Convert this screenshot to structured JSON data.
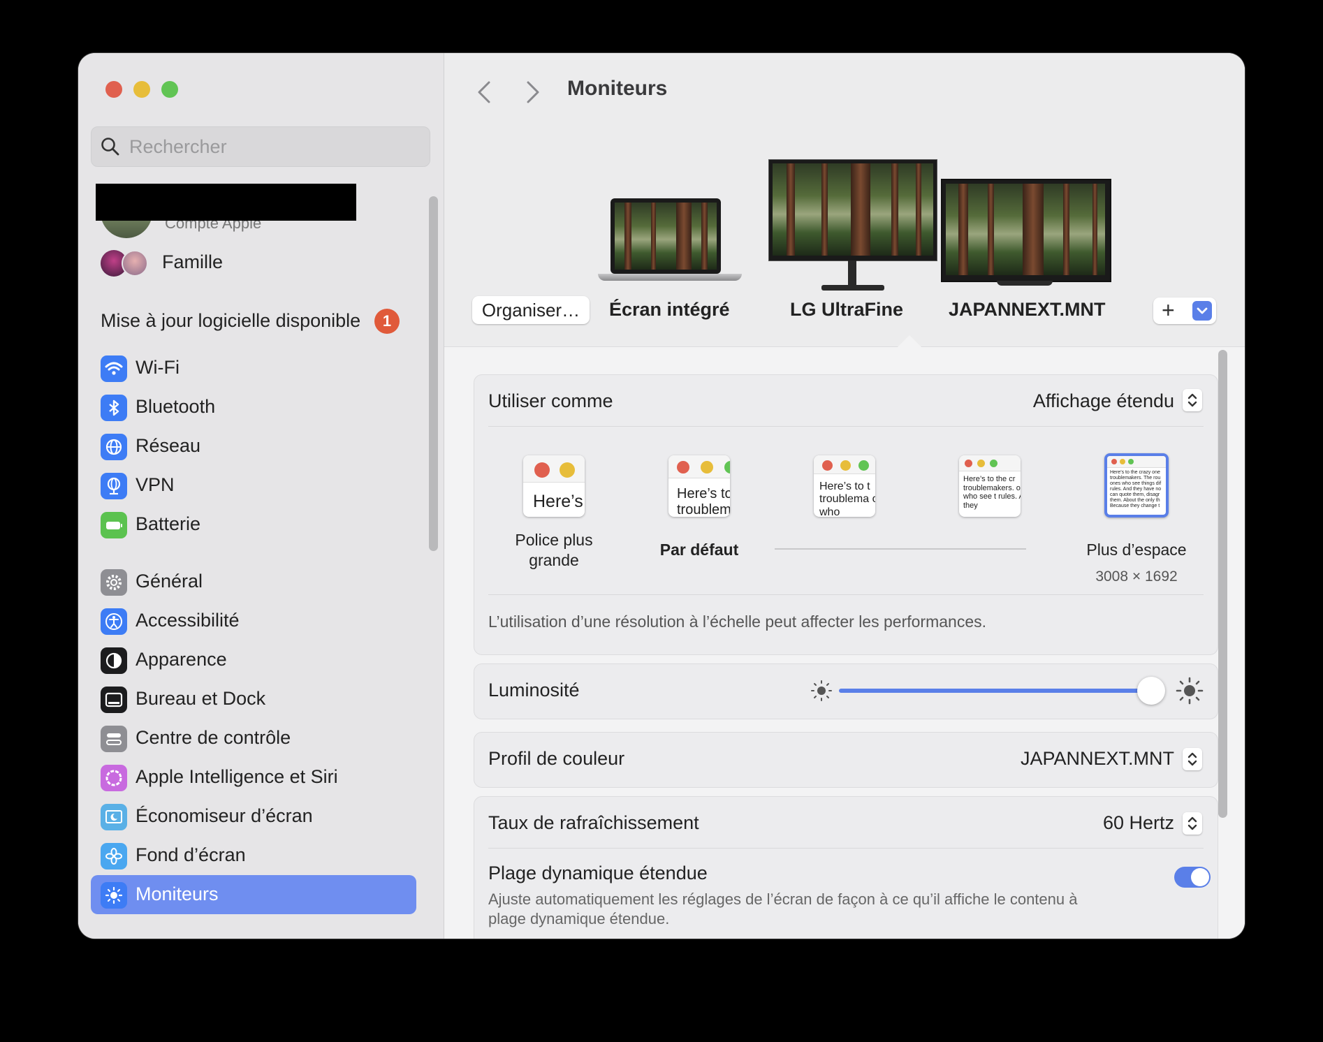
{
  "window": {
    "title": "Moniteurs"
  },
  "colors": {
    "accent": "#6f8ef0",
    "badge": "#e05a3a",
    "close": "#e0604f",
    "minimize": "#e7bd3a",
    "zoom": "#61c454"
  },
  "search": {
    "placeholder": "Rechercher"
  },
  "account": {
    "subtitle": "Compte Apple"
  },
  "family": {
    "label": "Famille"
  },
  "update": {
    "label": "Mise à jour logicielle disponible",
    "count": "1"
  },
  "sidebar": {
    "items": [
      {
        "label": "Wi-Fi",
        "icon": "wifi-icon",
        "color": "#3d7cf5"
      },
      {
        "label": "Bluetooth",
        "icon": "bluetooth-icon",
        "color": "#3d7cf5"
      },
      {
        "label": "Réseau",
        "icon": "globe-icon",
        "color": "#3d7cf5"
      },
      {
        "label": "VPN",
        "icon": "vpn-globe-icon",
        "color": "#3d7cf5"
      },
      {
        "label": "Batterie",
        "icon": "battery-icon",
        "color": "#5bc24f"
      },
      {
        "label": "Général",
        "icon": "gear-icon",
        "color": "#8e8e93"
      },
      {
        "label": "Accessibilité",
        "icon": "accessibility-icon",
        "color": "#3d7cf5"
      },
      {
        "label": "Apparence",
        "icon": "appearance-icon",
        "color": "#1c1c1e"
      },
      {
        "label": "Bureau et Dock",
        "icon": "dock-icon",
        "color": "#1c1c1e"
      },
      {
        "label": "Centre de contrôle",
        "icon": "control-center-icon",
        "color": "#8e8e93"
      },
      {
        "label": "Apple Intelligence et Siri",
        "icon": "siri-icon",
        "color": "#c86adf"
      },
      {
        "label": "Économiseur d’écran",
        "icon": "screensaver-icon",
        "color": "#5ab0e6"
      },
      {
        "label": "Fond d’écran",
        "icon": "wallpaper-icon",
        "color": "#4aa7f0"
      },
      {
        "label": "Moniteurs",
        "icon": "sun-icon",
        "color": "#3d7cf5",
        "selected": true
      }
    ]
  },
  "displays": {
    "organise": "Organiser…",
    "items": [
      {
        "label": "Écran intégré"
      },
      {
        "label": "LG UltraFine"
      },
      {
        "label": "JAPANNEXT.MNT",
        "selected": true
      }
    ],
    "add": "+"
  },
  "use_as": {
    "label": "Utiliser comme",
    "value": "Affichage étendu"
  },
  "resolution": {
    "options": [
      {
        "label": "Police plus grande",
        "sample": "Here’s"
      },
      {
        "label": "Par défaut",
        "sample": "Here’s to troublem"
      },
      {
        "label": "",
        "sample": "Here’s to t troublema ones who"
      },
      {
        "label": "",
        "sample": "Here’s to the cr troublemakers. ones who see t rules. And they"
      },
      {
        "label": "Plus d’espace",
        "sample": "Here’s to the crazy one troublemakers. The rou ones who see things dif rules. And they have no can quote them, disagr them. About the only th Because they change t",
        "selected": true
      }
    ],
    "current": "3008 × 1692",
    "note": "L’utilisation d’une résolution à l’échelle peut affecter les performances."
  },
  "brightness": {
    "label": "Luminosité",
    "value": 0.95
  },
  "color_profile": {
    "label": "Profil de couleur",
    "value": "JAPANNEXT.MNT"
  },
  "refresh": {
    "label": "Taux de rafraîchissement",
    "value": "60 Hertz"
  },
  "hdr": {
    "label": "Plage dynamique étendue",
    "description_line1": "Ajuste automatiquement les réglages de l’écran de façon à ce qu’il affiche le contenu à",
    "description_line2": "plage dynamique étendue.",
    "enabled": true
  }
}
